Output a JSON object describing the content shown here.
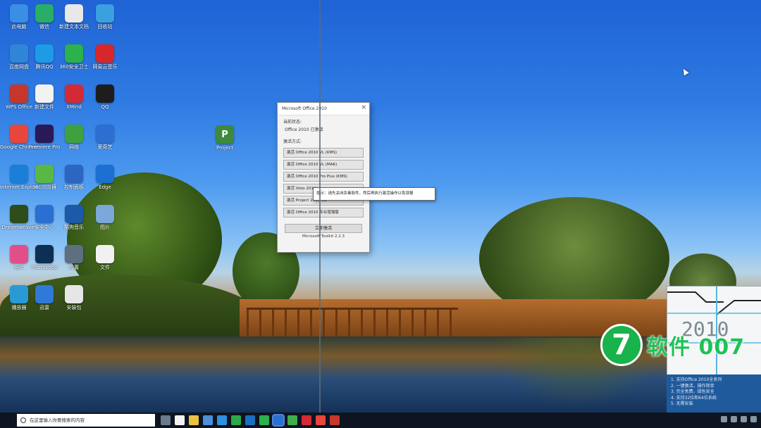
{
  "desktop": {
    "icons": [
      {
        "label": "此电脑",
        "color": "#3a8ee6",
        "icon": "recycle-bin-icon"
      },
      {
        "label": "微信",
        "color": "#2aae67",
        "icon": "wechat-icon"
      },
      {
        "label": "新建文本文档",
        "color": "#e8e8e8",
        "icon": "document-icon"
      },
      {
        "label": "回收站",
        "color": "#3aa0e0",
        "icon": "recycle-icon"
      },
      {
        "label": "百度网盘",
        "color": "#2f86d8",
        "icon": "cloud-drive-icon"
      },
      {
        "label": "腾讯QQ",
        "color": "#1e9be6",
        "icon": "chat-icon"
      },
      {
        "label": "360安全卫士",
        "color": "#2bb24c",
        "icon": "shield-icon"
      },
      {
        "label": "网易云音乐",
        "color": "#d7272b",
        "icon": "music-icon"
      },
      {
        "label": "WPS Office",
        "color": "#c7362c",
        "icon": "wps-icon"
      },
      {
        "label": "新建文件",
        "color": "#f2f2f2",
        "icon": "file-icon"
      },
      {
        "label": "XMind",
        "color": "#d42a36",
        "icon": "mindmap-icon"
      },
      {
        "label": "QQ",
        "color": "#1d1d1d",
        "icon": "penguin-icon"
      },
      {
        "label": "Google Chrome",
        "color": "#e8453c",
        "icon": "chrome-icon"
      },
      {
        "label": "Premiere Pro",
        "color": "#2a1959",
        "icon": "premiere-icon"
      },
      {
        "label": "网络",
        "color": "#3fa03f",
        "icon": "network-icon"
      },
      {
        "label": "爱奇艺",
        "color": "#2a6fd1",
        "icon": "video-icon"
      },
      {
        "label": "Internet Explorer",
        "color": "#1b7fd7",
        "icon": "ie-icon"
      },
      {
        "label": "360浏览器",
        "color": "#59b844",
        "icon": "browser-icon"
      },
      {
        "label": "控制面板",
        "color": "#2a66c2",
        "icon": "control-panel-icon"
      },
      {
        "label": "Edge",
        "color": "#1c6fd3",
        "icon": "edge-icon"
      },
      {
        "label": "Dreamweaver",
        "color": "#2d4d1a",
        "icon": "dreamweaver-icon"
      },
      {
        "label": "安全中心",
        "color": "#2a6fd1",
        "icon": "security-icon"
      },
      {
        "label": "酷狗音乐",
        "color": "#1b5aa8",
        "icon": "kugou-icon"
      },
      {
        "label": "图片",
        "color": "#7aa8d8",
        "icon": "image-icon"
      },
      {
        "label": "照片",
        "color": "#e14f8a",
        "icon": "photos-icon"
      },
      {
        "label": "Photoshop",
        "color": "#0d2f54",
        "icon": "photoshop-icon"
      },
      {
        "label": "设置",
        "color": "#5f6f80",
        "icon": "settings-icon"
      },
      {
        "label": "文件",
        "color": "#f1f1f1",
        "icon": "file-icon"
      },
      {
        "label": "播放器",
        "color": "#2a9ad6",
        "icon": "player-icon"
      },
      {
        "label": "迅雷",
        "color": "#2f7ad8",
        "icon": "thunder-icon"
      },
      {
        "label": "安装包",
        "color": "#e6e6e6",
        "icon": "installer-icon"
      },
      {
        "label": "Project",
        "color": "#3c8a3c",
        "icon": "project-icon"
      }
    ]
  },
  "dialog": {
    "title": "Microsoft Office 2010",
    "section1": "当前状态:",
    "status_value": "Office 2010 已激活",
    "section2": "激活方式:",
    "buttons": [
      "激活 Office 2010 VL (KMS)",
      "激活 Office 2010 VL (MAK)",
      "激活 Office 2010 Pro Plus (KMS)",
      "激活 Visio 2010 VL",
      "激活 Project 2010 VL",
      "激活 Office 2010 专业增强版"
    ],
    "apply": "立即激活",
    "footer": "Microsoft Toolkit 2.2.3",
    "tooltip": "提示：请先关闭杀毒软件，然后再执行激活操作以免误报"
  },
  "promo": {
    "year": "2010",
    "watermark": "软件 007",
    "info_lines": [
      "1. 支持Office 2010全系列",
      "2. 一键激活，操作简单",
      "3. 完全免费，绿色安全",
      "4. 支持32位和64位系统",
      "5. 无需安装"
    ]
  },
  "taskbar": {
    "search_placeholder": "在这里输入你要搜索的内容",
    "apps": [
      {
        "color": "#6b7a8c"
      },
      {
        "color": "#f3f3f3"
      },
      {
        "color": "#e9c244"
      },
      {
        "color": "#4a8fd8"
      },
      {
        "color": "#2f8fe0"
      },
      {
        "color": "#2aa84a"
      },
      {
        "color": "#1a6fc0"
      },
      {
        "color": "#2bb24c"
      },
      {
        "color": "#2a6fd1",
        "active": true
      },
      {
        "color": "#3fae4a"
      },
      {
        "color": "#d42a36"
      },
      {
        "color": "#e8453c"
      },
      {
        "color": "#c7362c"
      }
    ]
  }
}
